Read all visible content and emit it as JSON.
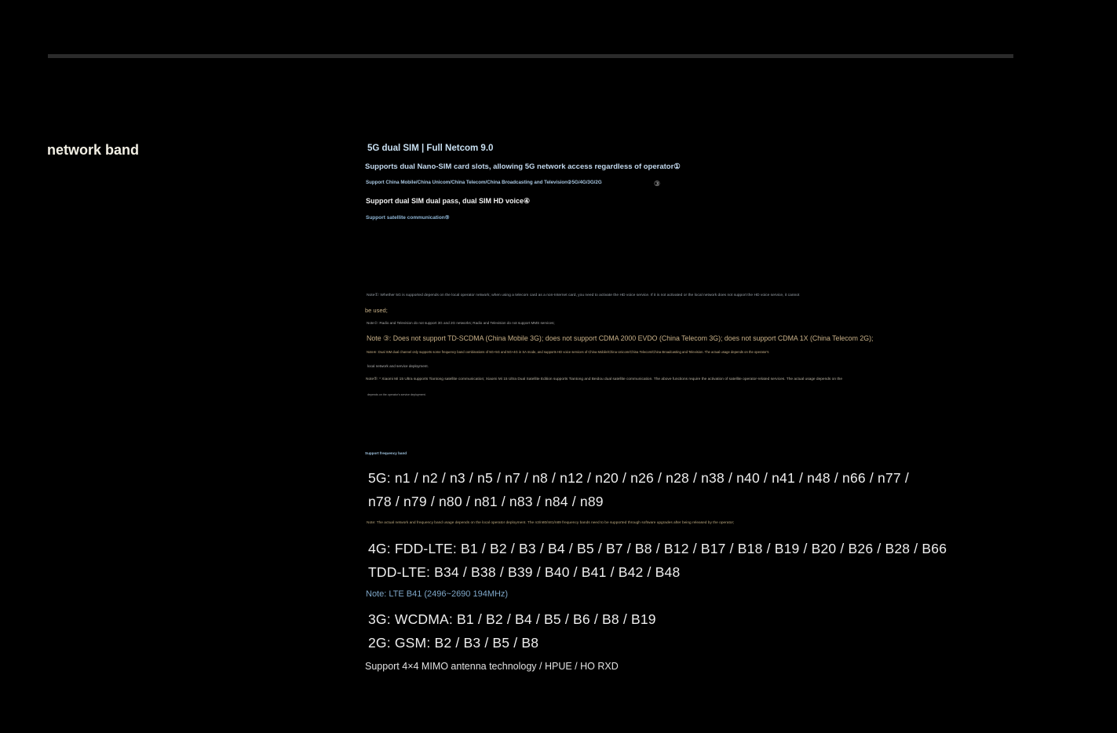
{
  "section_title": "network band",
  "header_lines": {
    "line1": "5G dual SIM | Full Netcom 9.0",
    "line2": "Supports dual Nano-SIM card slots, allowing 5G network access regardless of operator①",
    "line3": "Support China Mobile/China Unicom/China Telecom/China Broadcasting and Television②5G/4G/3G/2G",
    "line3_mark": "③",
    "line4": "Support dual SIM dual pass, dual SIM HD voice④",
    "line5": "Support satellite communication⑤"
  },
  "notes": {
    "note1": "Note①: Whether 5G is supported depends on the local operator network; when using a telecom card as a non-Internet card, you need to activate the HD voice service. If it is not activated or the local network does not support the HD voice service, it cannot",
    "note1_cont": "be used;",
    "note2": "Note②: Radio and Television do not support 3G and 2G networks; Radio and Television do not support MMS services;",
    "note3": "Note ③: Does not support TD-SCDMA (China Mobile 3G); does not support CDMA 2000 EVDO (China Telecom 3G); does not support CDMA 1X (China Telecom 2G);",
    "note4": "Note④: Dual SIM dual channel only supports some frequency band combinations of 5G+5G and 5G+4G in SA mode, and supports HD voice services of China Mobile/China Unicom/China Telecom/China Broadcasting and Television. The actual usage depends on the operator's",
    "note4_cont": "local network and service deployment.",
    "note5": "Note⑤: * Xiaomi Mi 15 Ultra supports Tiantong satellite communication; Xiaomi Mi 15 Ultra Dual Satellite Edition supports Tiantong and Beidou dual satellite communication. The above functions require the activation of satellite operator-related services. The actual usage depends on the",
    "note5_cont": " depends on the operator's service deployment."
  },
  "bands": {
    "label": "Support frequency band",
    "line_5g_a": "5G: n1 / n2 / n3 / n5 / n7 / n8 / n12 / n20 / n26 / n28 / n38 / n40 / n41 / n48 / n66 / n77 /",
    "line_5g_b": "n78 / n79 / n80 / n81 /  n83 / n84 / n89",
    "note_5g": "Note: The actual network and frequency band usage depends on the local operator deployment. The n3/n80/n81/n89 frequency bands need to be supported through software upgrades after being released by the operator;",
    "line_4g_fdd": "4G: FDD-LTE: B1 / B2 / B3 / B4 / B5 / B7 / B8 / B12 / B17 / B18 / B19 / B20 / B26 / B28 / B66",
    "line_4g_tdd": "TDD-LTE: B34 / B38 / B39 / B40 / B41 / B42 / B48",
    "note_lte": "Note: LTE B41 (2496~2690 194MHz)",
    "line_3g": "3G: WCDMA: B1 / B2 / B4 / B5 / B6 / B8 / B19",
    "line_2g": "2G: GSM: B2 / B3 / B5 / B8",
    "mimo": "Support 4×4 MIMO antenna technology / HPUE / HO RXD"
  }
}
